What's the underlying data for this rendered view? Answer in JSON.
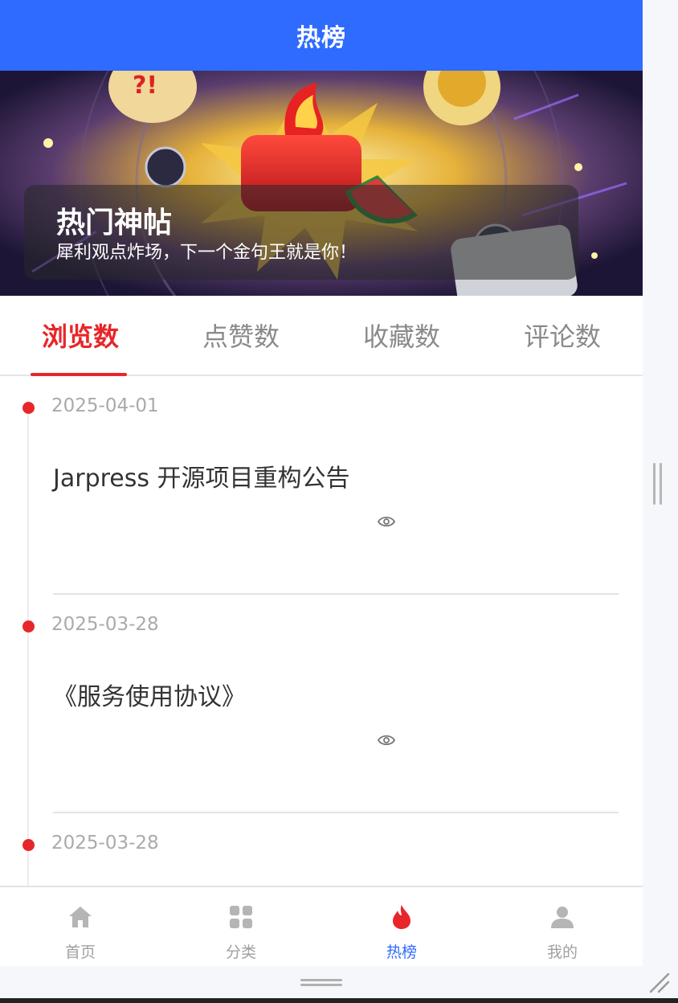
{
  "header": {
    "title": "热榜"
  },
  "banner": {
    "title": "热门神帖",
    "subtitle": "犀利观点炸场，下一个金句王就是你！"
  },
  "tabs": [
    {
      "label": "浏览数",
      "active": true
    },
    {
      "label": "点赞数",
      "active": false
    },
    {
      "label": "收藏数",
      "active": false
    },
    {
      "label": "评论数",
      "active": false
    }
  ],
  "posts": [
    {
      "date": "2025-04-01",
      "title": "Jarpress 开源项目重构公告",
      "icon": "eye-icon"
    },
    {
      "date": "2025-03-28",
      "title": "《服务使用协议》",
      "icon": "eye-icon"
    },
    {
      "date": "2025-03-28",
      "title": "",
      "icon": "eye-icon"
    }
  ],
  "tabbar": [
    {
      "label": "首页",
      "icon": "home-icon",
      "active": false
    },
    {
      "label": "分类",
      "icon": "grid-icon",
      "active": false
    },
    {
      "label": "热榜",
      "icon": "fire-icon",
      "active": true
    },
    {
      "label": "我的",
      "icon": "user-icon",
      "active": false
    }
  ],
  "colors": {
    "primary": "#2f6bff",
    "accent": "#e8262a",
    "inactive": "#a0a0a0"
  }
}
